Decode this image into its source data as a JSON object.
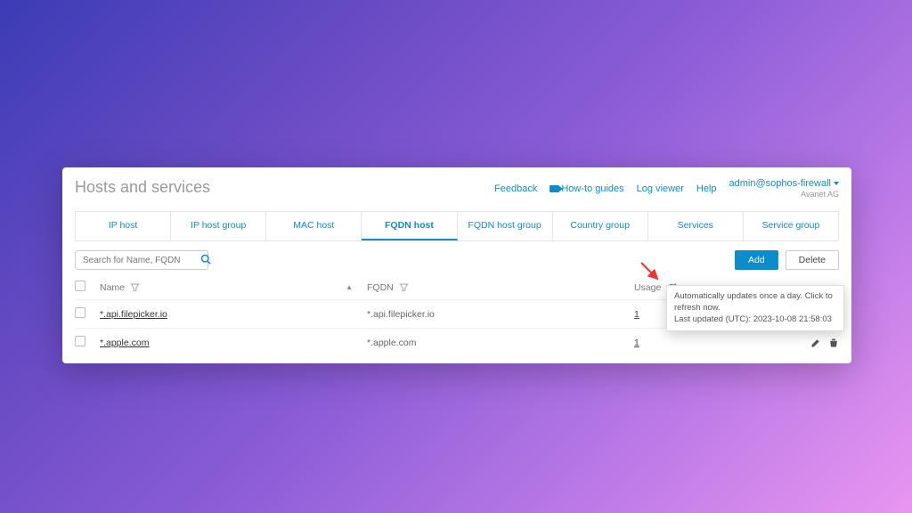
{
  "page_title": "Hosts and services",
  "top_links": {
    "feedback": "Feedback",
    "howto": "How-to guides",
    "log_viewer": "Log viewer",
    "help": "Help",
    "user": "admin@sophos-firewall",
    "org": "Avanet AG"
  },
  "tabs": [
    "IP host",
    "IP host group",
    "MAC host",
    "FQDN host",
    "FQDN host group",
    "Country group",
    "Services",
    "Service group"
  ],
  "active_tab_index": 3,
  "search": {
    "placeholder": "Search for Name, FQDN"
  },
  "buttons": {
    "add": "Add",
    "delete": "Delete"
  },
  "columns": {
    "name": "Name",
    "fqdn": "FQDN",
    "usage": "Usage"
  },
  "rows": [
    {
      "name": "*.api.filepicker.io",
      "fqdn": "*.api.filepicker.io",
      "usage": "1"
    },
    {
      "name": "*.apple.com",
      "fqdn": "*.apple.com",
      "usage": "1"
    }
  ],
  "tooltip": {
    "line1": "Automatically updates once a day. Click to refresh now.",
    "line2": "Last updated (UTC): 2023-10-08 21:58:03"
  }
}
